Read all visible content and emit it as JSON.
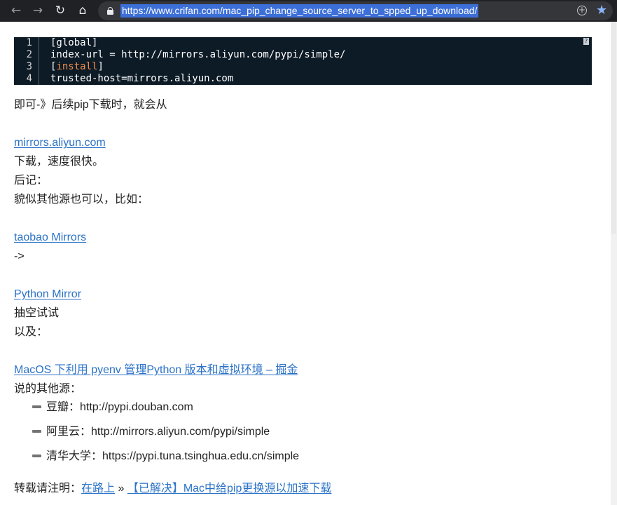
{
  "browser": {
    "url": "https://www.crifan.com/mac_pip_change_source_server_to_spped_up_download/"
  },
  "code": {
    "lines": [
      {
        "no": "1",
        "text": "[global]"
      },
      {
        "no": "2",
        "text": "index-url = http://mirrors.aliyun.com/pypi/simple/"
      },
      {
        "no": "3",
        "open": "[",
        "accent": "install",
        "close": "]"
      },
      {
        "no": "4",
        "text": "trusted-host=mirrors.aliyun.com"
      }
    ],
    "help_glyph": "?"
  },
  "article": {
    "line_jike": "即可-》后续pip下载时，就会从",
    "link_aliyun": "mirrors.aliyun.com",
    "line_download": "下载，速度很快。",
    "line_houji": "后记：",
    "line_maosi": "貌似其他源也可以，比如：",
    "link_taobao": "taobao Mirrors",
    "line_arrow": "->",
    "link_python_mirror": "Python Mirror",
    "line_choukong": "抽空试试",
    "line_yiji": "以及：",
    "link_juejin": "MacOS 下利用 pyenv 管理Python 版本和虚拟环境 – 掘金",
    "line_other_sources": "说的其他源：",
    "sources": [
      "豆瓣：http://pypi.douban.com",
      "阿里云：http://mirrors.aliyun.com/pypi/simple",
      "清华大学：https://pypi.tuna.tsinghua.edu.cn/simple"
    ],
    "footer_prefix": "转载请注明：",
    "footer_site": "在路上",
    "footer_sep": " » ",
    "footer_title": "【已解决】Mac中给pip更换源以加速下载"
  }
}
